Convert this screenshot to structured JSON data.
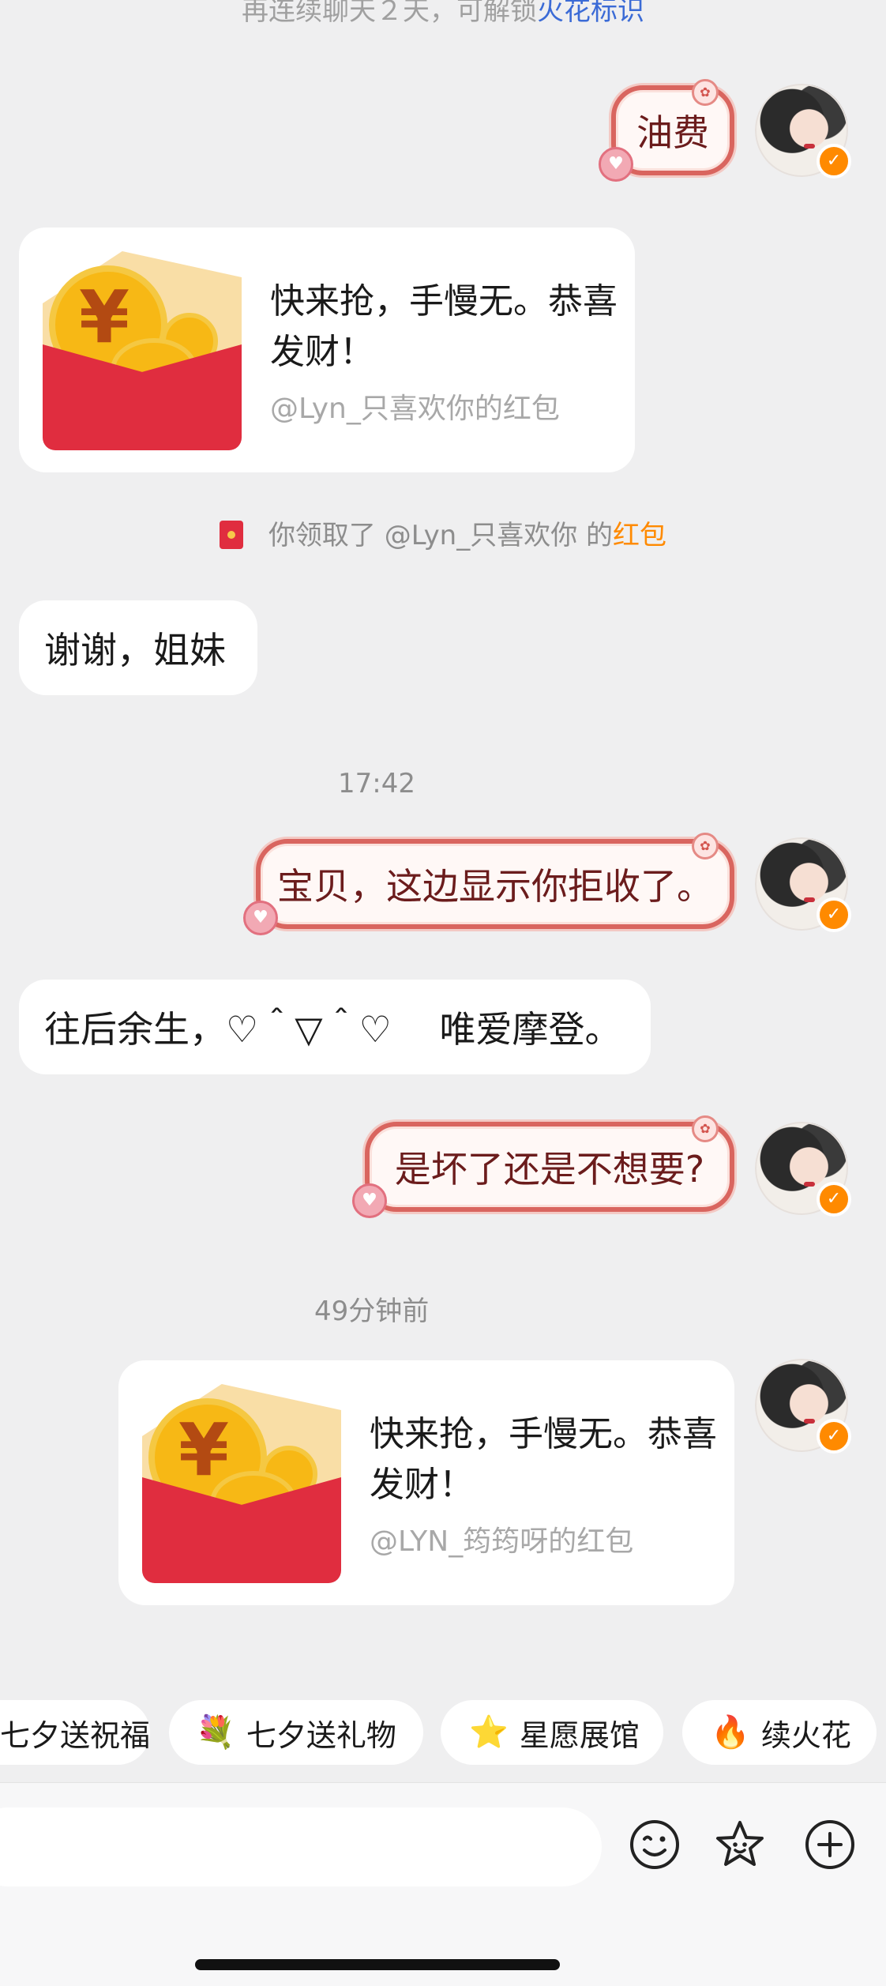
{
  "top_hint": {
    "text": "再连续聊天２天，可解锁",
    "link": "火花标识"
  },
  "messages": {
    "m1": "油费",
    "card1": {
      "title": "快来抢，手慢无。恭喜发财！",
      "from": "@Lyn_只喜欢你的红包"
    },
    "system": {
      "prefix": "你领取了 @Lyn_只喜欢你 的",
      "highlight": "红包"
    },
    "m2": "谢谢，姐妹",
    "time1": "17:42",
    "m3": "宝贝，这边显示你拒收了。",
    "m4": "往后余生，♡＾▽＾♡　 唯爱摩登。",
    "m5": "是坏了还是不想要?",
    "time2": "49分钟前",
    "card2": {
      "title": "快来抢，手慢无。恭喜发财！",
      "from": "@LYN_筠筠呀的红包"
    }
  },
  "chips": [
    {
      "icon": "",
      "label": "七夕送祝福"
    },
    {
      "icon": "💐",
      "label": "七夕送礼物"
    },
    {
      "icon": "⭐",
      "label": "星愿展馆"
    },
    {
      "icon": "🔥",
      "label": "续火花"
    }
  ],
  "colors": {
    "background": "#efeff0",
    "accent": "#ff8a00",
    "bubble_border": "#d9655f",
    "red_packet": "#e02d3f"
  }
}
